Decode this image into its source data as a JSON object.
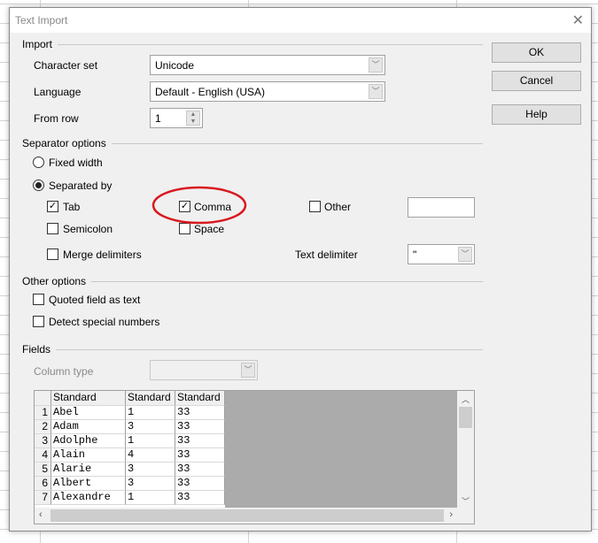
{
  "window": {
    "title": "Text Import",
    "close_icon": "close-icon"
  },
  "buttons": {
    "ok": "OK",
    "cancel": "Cancel",
    "help": "Help"
  },
  "import": {
    "section": "Import",
    "charset_label": "Character set",
    "charset_value": "Unicode",
    "language_label": "Language",
    "language_value": "Default - English (USA)",
    "from_row_label": "From row",
    "from_row_value": "1"
  },
  "separator": {
    "section": "Separator options",
    "fixed_width": "Fixed width",
    "separated_by": "Separated by",
    "mode": "separated_by",
    "tab": {
      "label": "Tab",
      "checked": true
    },
    "comma": {
      "label": "Comma",
      "checked": true
    },
    "other": {
      "label": "Other",
      "checked": false,
      "value": ""
    },
    "semicolon": {
      "label": "Semicolon",
      "checked": false
    },
    "space": {
      "label": "Space",
      "checked": false
    },
    "merge": {
      "label": "Merge delimiters",
      "checked": false
    },
    "text_delimiter_label": "Text delimiter",
    "text_delimiter_value": "\""
  },
  "other_options": {
    "section": "Other options",
    "quoted": {
      "label": "Quoted field as text",
      "checked": false
    },
    "detect": {
      "label": "Detect special numbers",
      "checked": false
    }
  },
  "fields": {
    "section": "Fields",
    "column_type_label": "Column type",
    "column_type_value": "",
    "headers": [
      "Standard",
      "Standard",
      "Standard"
    ],
    "rows": [
      [
        "1",
        "Abel",
        "1",
        "33"
      ],
      [
        "2",
        "Adam",
        "3",
        "33"
      ],
      [
        "3",
        "Adolphe",
        "1",
        "33"
      ],
      [
        "4",
        "Alain",
        "4",
        "33"
      ],
      [
        "5",
        "Alarie",
        "3",
        "33"
      ],
      [
        "6",
        "Albert",
        "3",
        "33"
      ],
      [
        "7",
        "Alexandre",
        "1",
        "33"
      ]
    ]
  },
  "annotation": {
    "color": "#d9181e"
  }
}
